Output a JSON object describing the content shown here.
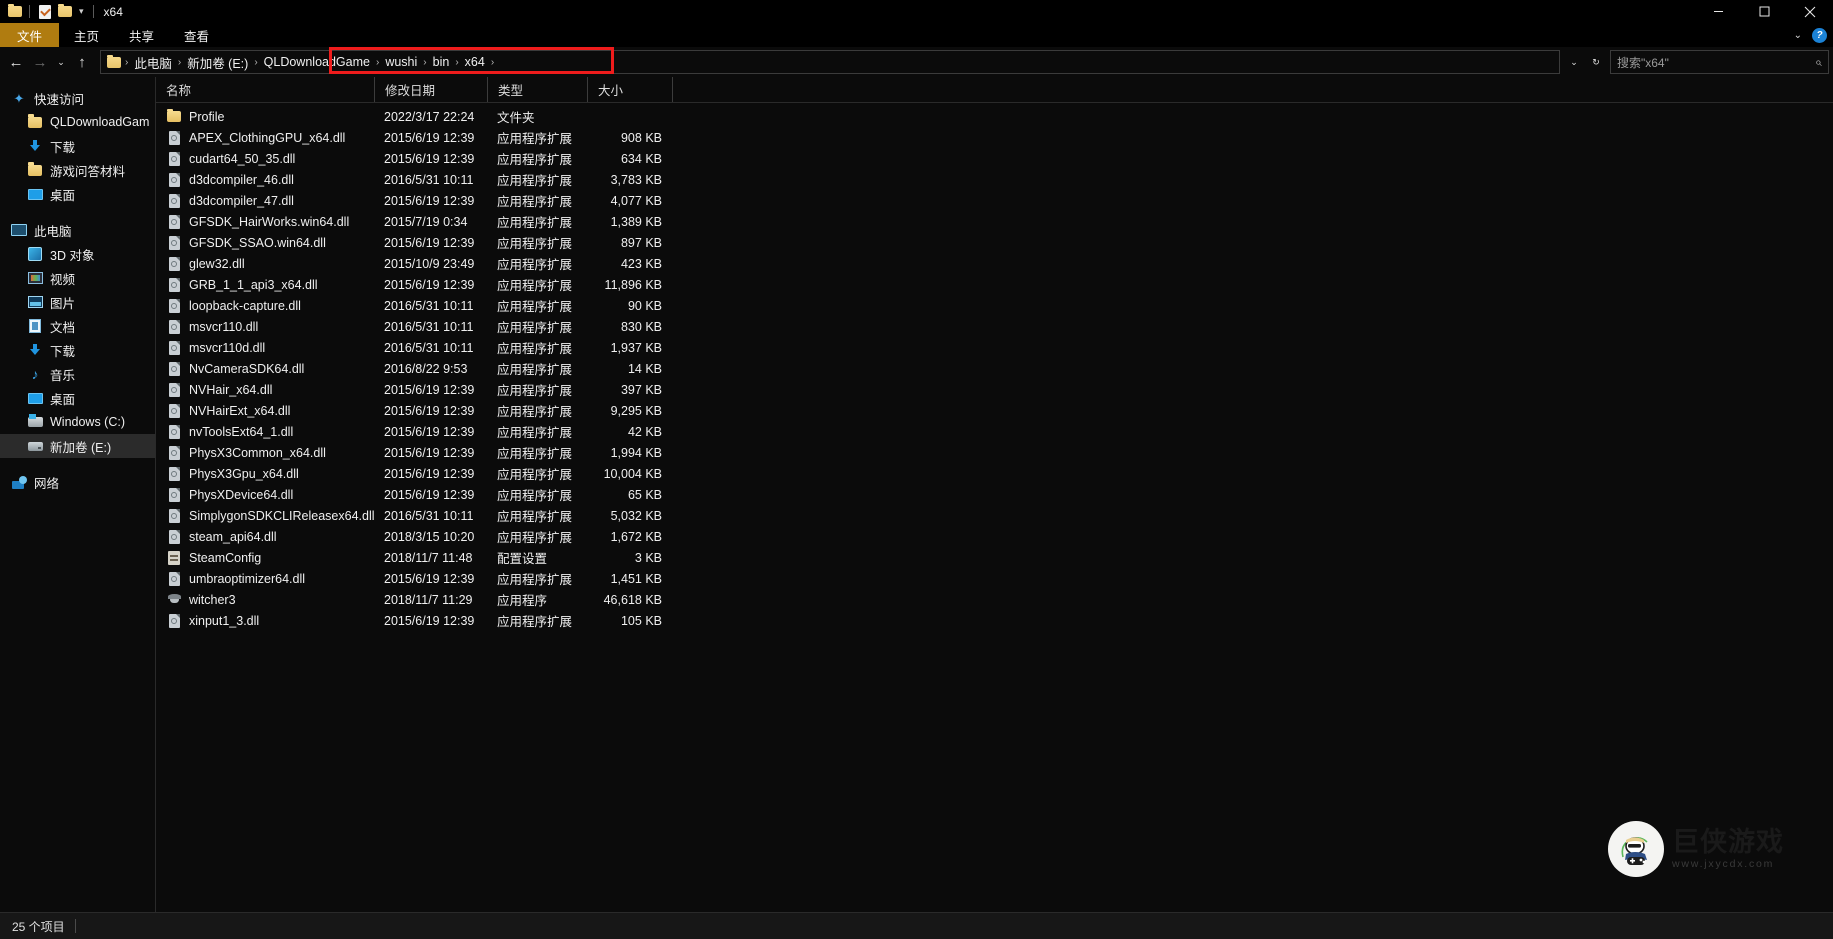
{
  "window": {
    "title": "x64",
    "quick_access_icons": [
      "folder-icon",
      "properties-icon",
      "new-folder-icon",
      "customize-caret-icon"
    ],
    "controls": {
      "minimize": "minimize-icon",
      "maximize": "maximize-icon",
      "close": "close-icon"
    }
  },
  "ribbon": {
    "tabs": [
      {
        "label": "文件",
        "active": true
      },
      {
        "label": "主页",
        "active": false
      },
      {
        "label": "共享",
        "active": false
      },
      {
        "label": "查看",
        "active": false
      }
    ],
    "collapse_icon": "chevron-down-icon",
    "help_icon": "help-icon"
  },
  "address": {
    "back_icon": "back-arrow-icon",
    "forward_icon": "forward-arrow-icon",
    "recent_icon": "recent-locations-icon",
    "up_icon": "up-arrow-icon",
    "crumbs": [
      "此电脑",
      "新加卷 (E:)",
      "QLDownloadGame",
      "wushi",
      "bin",
      "x64"
    ],
    "separator": "›",
    "dropdown_icon": "chevron-down-icon",
    "refresh_icon": "refresh-icon",
    "highlight_color": "#ef1c1c"
  },
  "search": {
    "placeholder": "搜索\"x64\"",
    "icon": "search-icon"
  },
  "sidebar": {
    "groups": [
      {
        "header": {
          "label": "快速访问",
          "icon": "star-pin-icon"
        },
        "items": [
          {
            "label": "QLDownloadGam",
            "icon": "folder-icon"
          },
          {
            "label": "下载",
            "icon": "download-icon"
          },
          {
            "label": "游戏问答材料",
            "icon": "folder-icon"
          },
          {
            "label": "桌面",
            "icon": "desktop-icon"
          }
        ]
      },
      {
        "header": {
          "label": "此电脑",
          "icon": "this-pc-icon"
        },
        "items": [
          {
            "label": "3D 对象",
            "icon": "3d-objects-icon"
          },
          {
            "label": "视频",
            "icon": "videos-icon"
          },
          {
            "label": "图片",
            "icon": "pictures-icon"
          },
          {
            "label": "文档",
            "icon": "documents-icon"
          },
          {
            "label": "下载",
            "icon": "download-icon"
          },
          {
            "label": "音乐",
            "icon": "music-icon"
          },
          {
            "label": "桌面",
            "icon": "desktop-icon"
          },
          {
            "label": "Windows (C:)",
            "icon": "drive-windows-icon"
          },
          {
            "label": "新加卷 (E:)",
            "icon": "drive-icon",
            "selected": true
          }
        ]
      },
      {
        "header": {
          "label": "网络",
          "icon": "network-icon"
        },
        "items": []
      }
    ]
  },
  "filelist": {
    "columns": [
      {
        "label": "名称",
        "key": "name"
      },
      {
        "label": "修改日期",
        "key": "date"
      },
      {
        "label": "类型",
        "key": "type"
      },
      {
        "label": "大小",
        "key": "size"
      }
    ],
    "rows": [
      {
        "name": "Profile",
        "date": "2022/3/17 22:24",
        "type": "文件夹",
        "size": "",
        "icon": "folder-icon"
      },
      {
        "name": "APEX_ClothingGPU_x64.dll",
        "date": "2015/6/19 12:39",
        "type": "应用程序扩展",
        "size": "908 KB",
        "icon": "dll-icon"
      },
      {
        "name": "cudart64_50_35.dll",
        "date": "2015/6/19 12:39",
        "type": "应用程序扩展",
        "size": "634 KB",
        "icon": "dll-icon"
      },
      {
        "name": "d3dcompiler_46.dll",
        "date": "2016/5/31 10:11",
        "type": "应用程序扩展",
        "size": "3,783 KB",
        "icon": "dll-icon"
      },
      {
        "name": "d3dcompiler_47.dll",
        "date": "2015/6/19 12:39",
        "type": "应用程序扩展",
        "size": "4,077 KB",
        "icon": "dll-icon"
      },
      {
        "name": "GFSDK_HairWorks.win64.dll",
        "date": "2015/7/19 0:34",
        "type": "应用程序扩展",
        "size": "1,389 KB",
        "icon": "dll-icon"
      },
      {
        "name": "GFSDK_SSAO.win64.dll",
        "date": "2015/6/19 12:39",
        "type": "应用程序扩展",
        "size": "897 KB",
        "icon": "dll-icon"
      },
      {
        "name": "glew32.dll",
        "date": "2015/10/9 23:49",
        "type": "应用程序扩展",
        "size": "423 KB",
        "icon": "dll-icon"
      },
      {
        "name": "GRB_1_1_api3_x64.dll",
        "date": "2015/6/19 12:39",
        "type": "应用程序扩展",
        "size": "11,896 KB",
        "icon": "dll-icon"
      },
      {
        "name": "loopback-capture.dll",
        "date": "2016/5/31 10:11",
        "type": "应用程序扩展",
        "size": "90 KB",
        "icon": "dll-icon"
      },
      {
        "name": "msvcr110.dll",
        "date": "2016/5/31 10:11",
        "type": "应用程序扩展",
        "size": "830 KB",
        "icon": "dll-icon"
      },
      {
        "name": "msvcr110d.dll",
        "date": "2016/5/31 10:11",
        "type": "应用程序扩展",
        "size": "1,937 KB",
        "icon": "dll-icon"
      },
      {
        "name": "NvCameraSDK64.dll",
        "date": "2016/8/22 9:53",
        "type": "应用程序扩展",
        "size": "14 KB",
        "icon": "dll-icon"
      },
      {
        "name": "NVHair_x64.dll",
        "date": "2015/6/19 12:39",
        "type": "应用程序扩展",
        "size": "397 KB",
        "icon": "dll-icon"
      },
      {
        "name": "NVHairExt_x64.dll",
        "date": "2015/6/19 12:39",
        "type": "应用程序扩展",
        "size": "9,295 KB",
        "icon": "dll-icon"
      },
      {
        "name": "nvToolsExt64_1.dll",
        "date": "2015/6/19 12:39",
        "type": "应用程序扩展",
        "size": "42 KB",
        "icon": "dll-icon"
      },
      {
        "name": "PhysX3Common_x64.dll",
        "date": "2015/6/19 12:39",
        "type": "应用程序扩展",
        "size": "1,994 KB",
        "icon": "dll-icon"
      },
      {
        "name": "PhysX3Gpu_x64.dll",
        "date": "2015/6/19 12:39",
        "type": "应用程序扩展",
        "size": "10,004 KB",
        "icon": "dll-icon"
      },
      {
        "name": "PhysXDevice64.dll",
        "date": "2015/6/19 12:39",
        "type": "应用程序扩展",
        "size": "65 KB",
        "icon": "dll-icon"
      },
      {
        "name": "SimplygonSDKCLIReleasex64.dll",
        "date": "2016/5/31 10:11",
        "type": "应用程序扩展",
        "size": "5,032 KB",
        "icon": "dll-icon"
      },
      {
        "name": "steam_api64.dll",
        "date": "2018/3/15 10:20",
        "type": "应用程序扩展",
        "size": "1,672 KB",
        "icon": "dll-icon"
      },
      {
        "name": "SteamConfig",
        "date": "2018/11/7 11:48",
        "type": "配置设置",
        "size": "3 KB",
        "icon": "config-icon"
      },
      {
        "name": "umbraoptimizer64.dll",
        "date": "2015/6/19 12:39",
        "type": "应用程序扩展",
        "size": "1,451 KB",
        "icon": "dll-icon"
      },
      {
        "name": "witcher3",
        "date": "2018/11/7 11:29",
        "type": "应用程序",
        "size": "46,618 KB",
        "icon": "exe-icon"
      },
      {
        "name": "xinput1_3.dll",
        "date": "2015/6/19 12:39",
        "type": "应用程序扩展",
        "size": "105 KB",
        "icon": "dll-icon"
      }
    ]
  },
  "status": {
    "item_count": "25 个项目"
  },
  "watermark": {
    "brand": "巨侠游戏",
    "url": "www.jxycdx.com"
  }
}
